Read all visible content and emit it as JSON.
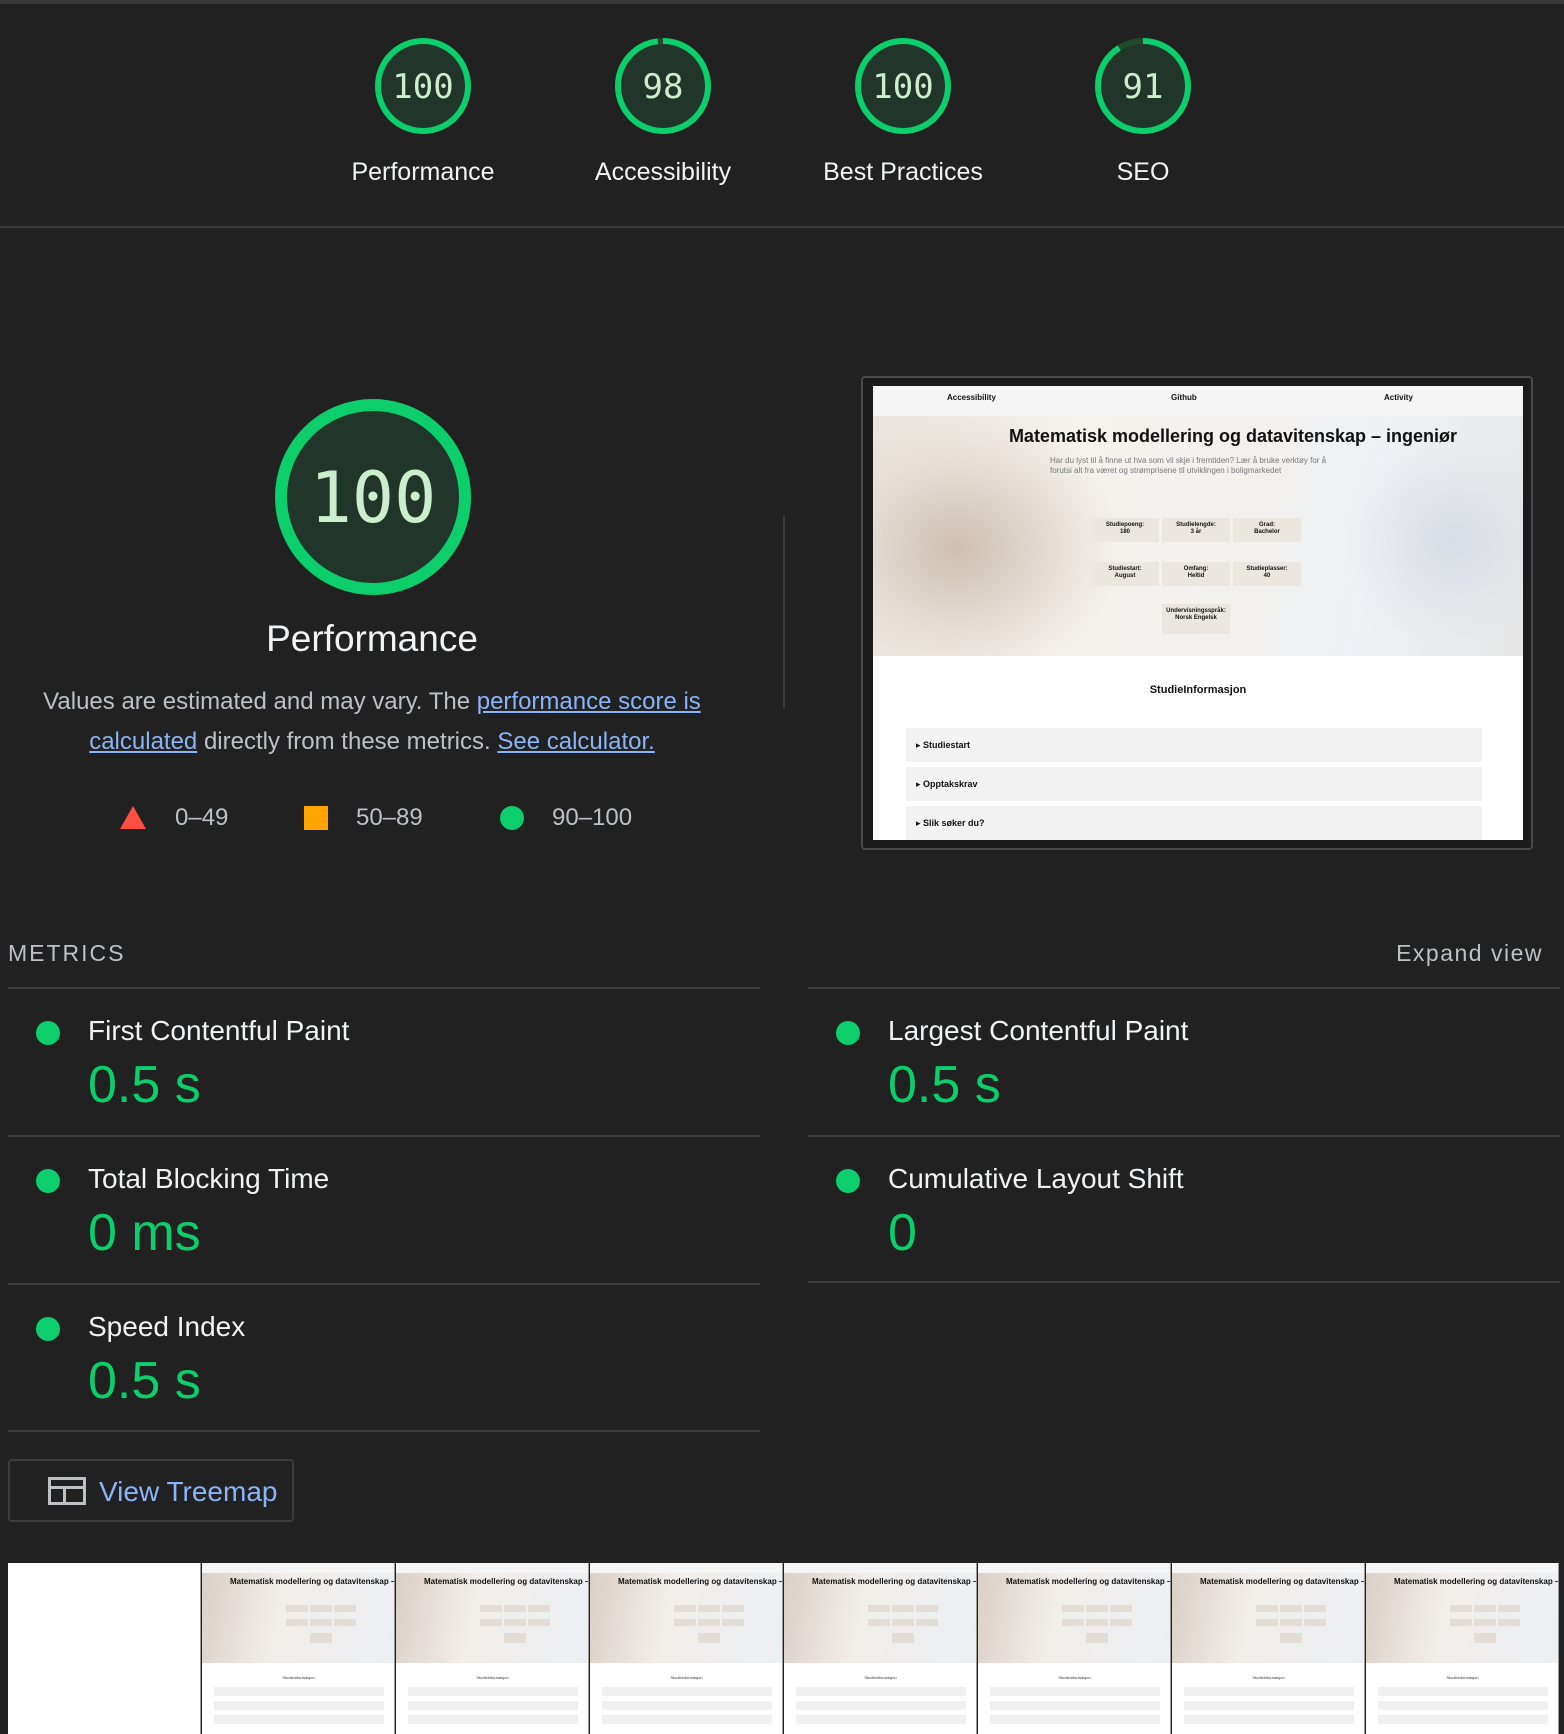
{
  "gauges": [
    {
      "score": "100",
      "label": "Performance",
      "fraction": 1.0
    },
    {
      "score": "98",
      "label": "Accessibility",
      "fraction": 0.98
    },
    {
      "score": "100",
      "label": "Best Practices",
      "fraction": 1.0
    },
    {
      "score": "91",
      "label": "SEO",
      "fraction": 0.91
    }
  ],
  "performance": {
    "score": "100",
    "fraction": 1.0,
    "title": "Performance",
    "desc_prefix": "Values are estimated and may vary. The ",
    "desc_link1": "performance score is calculated",
    "desc_middle": " directly from these metrics. ",
    "desc_link2": "See calculator."
  },
  "legend": {
    "fail": "0–49",
    "average": "50–89",
    "pass": "90–100"
  },
  "colors": {
    "pass": "#0cce6b",
    "average": "#ffa400",
    "fail": "#ff4e42",
    "background": "#212121",
    "link": "#8ab4f8"
  },
  "preview": {
    "nav": [
      "Accessibility",
      "Github",
      "Activity"
    ],
    "title": "Matematisk modellering og datavitenskap – ingeniør",
    "subtitle": "Har du lyst til å finne ut hva som vil skje i fremtiden? Lær å bruke verktøy for å forutsi alt fra været og strømprisene til utviklingen i boligmarkedet",
    "cards": [
      {
        "label": "Studiepoeng:",
        "value": "180"
      },
      {
        "label": "Studielengde:",
        "value": "3 år"
      },
      {
        "label": "Grad:",
        "value": "Bachelor"
      },
      {
        "label": "Studiestart:",
        "value": "August"
      },
      {
        "label": "Omfang:",
        "value": "Heltid"
      },
      {
        "label": "Studieplasser:",
        "value": "40"
      },
      {
        "label": "Undervisningsspråk:",
        "value": "Norsk Engelsk"
      }
    ],
    "section": "StudieInformasjon",
    "accordion": [
      "Studiestart",
      "Opptakskrav",
      "Slik søker du?"
    ]
  },
  "metrics": {
    "heading": "METRICS",
    "expand": "Expand view",
    "items": [
      {
        "title": "First Contentful Paint",
        "value": "0.5 s"
      },
      {
        "title": "Largest Contentful Paint",
        "value": "0.5 s"
      },
      {
        "title": "Total Blocking Time",
        "value": "0 ms"
      },
      {
        "title": "Cumulative Layout Shift",
        "value": "0"
      },
      {
        "title": "Speed Index",
        "value": "0.5 s"
      }
    ]
  },
  "treemap": {
    "label": "View Treemap",
    "icon": "treemap-icon"
  },
  "filmstrip": {
    "frame_title": "Matematisk modellering og datavitenskap – ingeniør",
    "frame_section": "StudieInformasjon"
  }
}
